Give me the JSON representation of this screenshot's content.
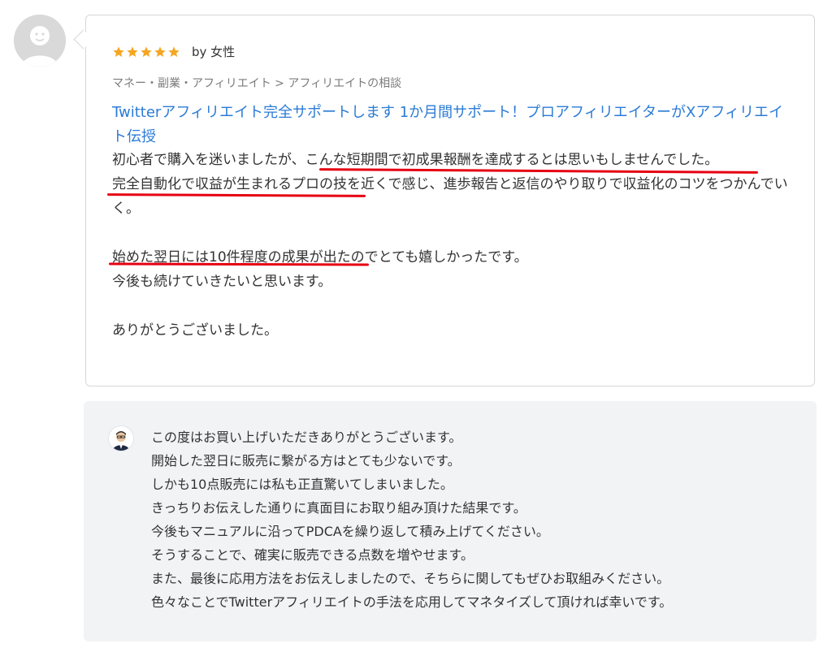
{
  "review": {
    "rating": 5,
    "reviewer": "by 女性",
    "breadcrumb": "マネー・副業・アフィリエイト > アフィリエイトの相談",
    "service_title": "Twitterアフィリエイト完全サポートします 1か月間サポート！プロアフィリエイターがXアフィリエイト伝授",
    "body": "初心者で購入を迷いましたが、こんな短期間で初成果報酬を達成するとは思いもしませんでした。\n完全自動化で収益が生まれるプロの技を近くで感じ、進歩報告と返信のやり取りで収益化のコツをつかんでいく。\n\n始めた翌日には10件程度の成果が出たのでとても嬉しかったです。\n今後も続けていきたいと思います。\n\nありがとうございました。"
  },
  "reply": {
    "text": "この度はお買い上げいただきありがとうございます。\n開始した翌日に販売に繋がる方はとても少ないです。\nしかも10点販売には私も正直驚いてしまいました。\nきっちりお伝えした通りに真面目にお取り組み頂けた結果です。\n今後もマニュアルに沿ってPDCAを繰り返して積み上げてください。\nそうすることで、確実に販売できる点数を増やせます。\nまた、最後に応用方法をお伝えしましたので、そちらに関してもぜひお取組みください。\n色々なことでTwitterアフィリエイトの手法を応用してマネタイズして頂ければ幸いです。"
  },
  "colors": {
    "star": "#f5a623",
    "link": "#2b7bd6",
    "underline": "#e60012",
    "reply_bg": "#f2f3f5"
  }
}
